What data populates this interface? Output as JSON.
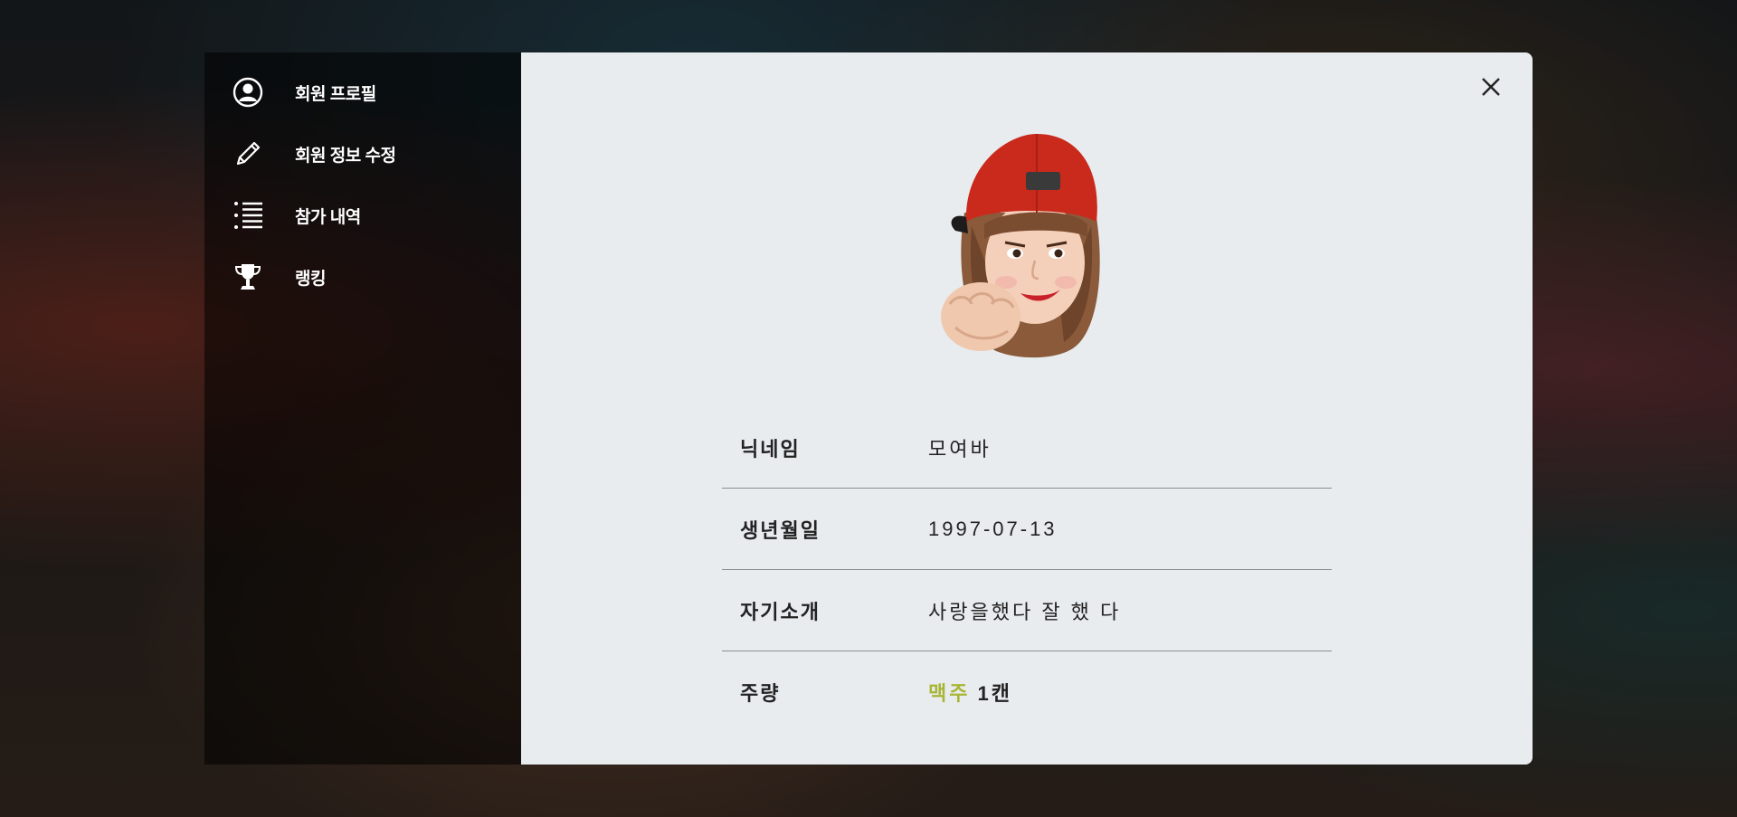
{
  "sidebar": {
    "items": [
      {
        "label": "회원 프로필",
        "icon": "user-circle-icon"
      },
      {
        "label": "회원 정보 수정",
        "icon": "pencil-icon"
      },
      {
        "label": "참가 내역",
        "icon": "list-icon"
      },
      {
        "label": "랭킹",
        "icon": "trophy-icon"
      }
    ]
  },
  "modal": {
    "close_icon": "close-icon",
    "avatar": "memoji-avatar-red-cap",
    "fields": {
      "nickname": {
        "label": "닉네임",
        "value": "모여바"
      },
      "birthdate": {
        "label": "생년월일",
        "value": "1997-07-13"
      },
      "intro": {
        "label": "자기소개",
        "value": "사랑을했다 잘 했 다"
      },
      "drinking": {
        "label": "주량",
        "drink": "맥주",
        "amount": "1캔"
      }
    }
  },
  "colors": {
    "modal_bg": "#e9ecef",
    "drink_accent": "#a8b535",
    "sidebar_bg": "rgba(0,0,0,0.55)"
  }
}
